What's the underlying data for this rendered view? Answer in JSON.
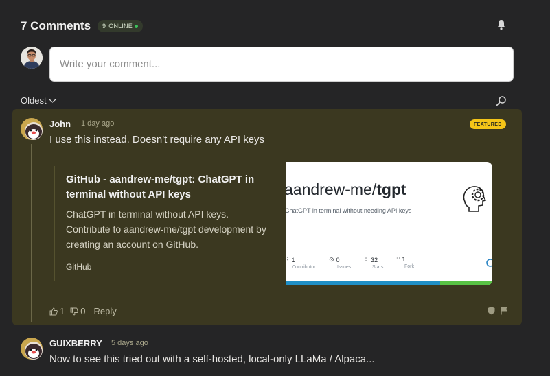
{
  "header": {
    "comment_count": "7 Comments",
    "online_count": "9",
    "online_label": "ONLINE"
  },
  "composer": {
    "placeholder": "Write your comment..."
  },
  "sort": {
    "label": "Oldest"
  },
  "comments": [
    {
      "author": "John",
      "time": "1 day ago",
      "badge": "FEATURED",
      "text": "I use this instead. Doesn't require any API keys",
      "link_preview": {
        "title": "GitHub - aandrew-me/tgpt: ChatGPT in terminal without API keys",
        "description": "ChatGPT in terminal without API keys. Contribute to aandrew-me/tgpt development by creating an account on GitHub.",
        "source": "GitHub",
        "image": {
          "repo_owner": "aandrew-me/",
          "repo_name": "tgpt",
          "repo_desc": "ChatGPT in terminal without needing API keys",
          "stats": [
            {
              "value": "1",
              "label": "Contributor"
            },
            {
              "value": "0",
              "label": "Issues"
            },
            {
              "value": "32",
              "label": "Stars"
            },
            {
              "value": "1",
              "label": "Fork"
            }
          ]
        }
      },
      "upvotes": "1",
      "downvotes": "0",
      "reply_label": "Reply"
    },
    {
      "author": "GUIXBERRY",
      "time": "5 days ago",
      "text": "Now to see this tried out with a self-hosted, local-only LLaMa / Alpaca..."
    }
  ],
  "colors": {
    "background": "#252526",
    "featured_card": "#3b3820",
    "featured_badge": "#f5c518",
    "online_dot": "#3cc35c"
  }
}
